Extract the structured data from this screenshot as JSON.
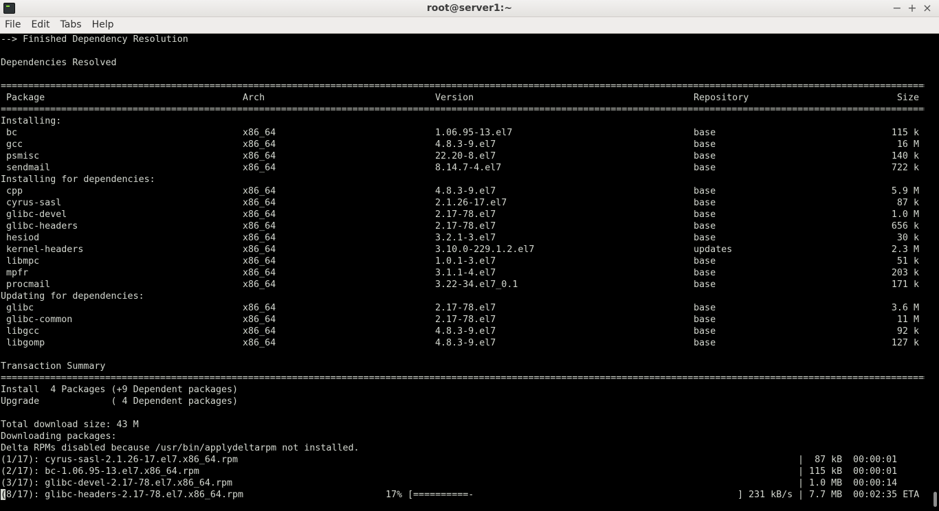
{
  "window": {
    "title": "root@server1:~"
  },
  "window_controls": {
    "minimize": "−",
    "maximize": "+",
    "close": "×"
  },
  "menu": {
    "items": [
      "File",
      "Edit",
      "Tabs",
      "Help"
    ]
  },
  "terminal": {
    "finished_line": "--> Finished Dependency Resolution",
    "resolved_line": "Dependencies Resolved",
    "separator": "================================================================================================================================================================================================================================================================================================================================================================================",
    "headers": {
      "package": "Package",
      "arch": "Arch",
      "version": "Version",
      "repository": "Repository",
      "size": "Size"
    },
    "sections": [
      {
        "title": "Installing:",
        "rows": [
          {
            "package": "bc",
            "arch": "x86_64",
            "version": "1.06.95-13.el7",
            "repository": "base",
            "size": "115 k"
          },
          {
            "package": "gcc",
            "arch": "x86_64",
            "version": "4.8.3-9.el7",
            "repository": "base",
            "size": "16 M"
          },
          {
            "package": "psmisc",
            "arch": "x86_64",
            "version": "22.20-8.el7",
            "repository": "base",
            "size": "140 k"
          },
          {
            "package": "sendmail",
            "arch": "x86_64",
            "version": "8.14.7-4.el7",
            "repository": "base",
            "size": "722 k"
          }
        ]
      },
      {
        "title": "Installing for dependencies:",
        "rows": [
          {
            "package": "cpp",
            "arch": "x86_64",
            "version": "4.8.3-9.el7",
            "repository": "base",
            "size": "5.9 M"
          },
          {
            "package": "cyrus-sasl",
            "arch": "x86_64",
            "version": "2.1.26-17.el7",
            "repository": "base",
            "size": "87 k"
          },
          {
            "package": "glibc-devel",
            "arch": "x86_64",
            "version": "2.17-78.el7",
            "repository": "base",
            "size": "1.0 M"
          },
          {
            "package": "glibc-headers",
            "arch": "x86_64",
            "version": "2.17-78.el7",
            "repository": "base",
            "size": "656 k"
          },
          {
            "package": "hesiod",
            "arch": "x86_64",
            "version": "3.2.1-3.el7",
            "repository": "base",
            "size": "30 k"
          },
          {
            "package": "kernel-headers",
            "arch": "x86_64",
            "version": "3.10.0-229.1.2.el7",
            "repository": "updates",
            "size": "2.3 M"
          },
          {
            "package": "libmpc",
            "arch": "x86_64",
            "version": "1.0.1-3.el7",
            "repository": "base",
            "size": "51 k"
          },
          {
            "package": "mpfr",
            "arch": "x86_64",
            "version": "3.1.1-4.el7",
            "repository": "base",
            "size": "203 k"
          },
          {
            "package": "procmail",
            "arch": "x86_64",
            "version": "3.22-34.el7_0.1",
            "repository": "base",
            "size": "171 k"
          }
        ]
      },
      {
        "title": "Updating for dependencies:",
        "rows": [
          {
            "package": "glibc",
            "arch": "x86_64",
            "version": "2.17-78.el7",
            "repository": "base",
            "size": "3.6 M"
          },
          {
            "package": "glibc-common",
            "arch": "x86_64",
            "version": "2.17-78.el7",
            "repository": "base",
            "size": "11 M"
          },
          {
            "package": "libgcc",
            "arch": "x86_64",
            "version": "4.8.3-9.el7",
            "repository": "base",
            "size": "92 k"
          },
          {
            "package": "libgomp",
            "arch": "x86_64",
            "version": "4.8.3-9.el7",
            "repository": "base",
            "size": "127 k"
          }
        ]
      }
    ],
    "summary_title": "Transaction Summary",
    "install_summary": "Install  4 Packages (+9 Dependent packages)",
    "upgrade_summary": "Upgrade             ( 4 Dependent packages)",
    "total_download": "Total download size: 43 M",
    "downloading": "Downloading packages:",
    "delta_note": "Delta RPMs disabled because /usr/bin/applydeltarpm not installed.",
    "downloads": [
      {
        "name": "(1/17): cyrus-sasl-2.1.26-17.el7.x86_64.rpm",
        "size": "|  87 kB",
        "time": "00:00:01"
      },
      {
        "name": "(2/17): bc-1.06.95-13.el7.x86_64.rpm",
        "size": "| 115 kB",
        "time": "00:00:01"
      },
      {
        "name": "(3/17): glibc-devel-2.17-78.el7.x86_64.rpm",
        "size": "| 1.0 MB",
        "time": "00:00:14"
      }
    ],
    "progress": {
      "cursor_char": "(",
      "name": "8/17): glibc-headers-2.17-78.el7.x86_64.rpm",
      "percent": "17%",
      "bar": "[==========-",
      "bar_end": "]",
      "rate": "231 kB/s",
      "size": "| 7.7 MB",
      "eta": "00:02:35 ETA"
    }
  }
}
